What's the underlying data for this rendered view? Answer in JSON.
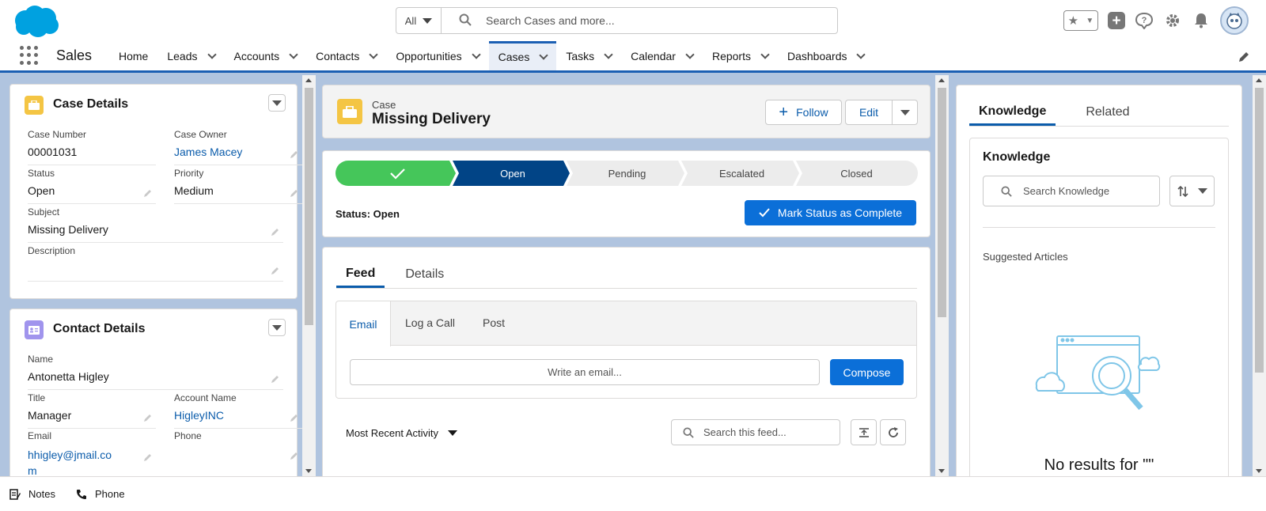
{
  "header": {
    "search_scope": "All",
    "search_placeholder": "Search Cases and more..."
  },
  "nav": {
    "app_name": "Sales",
    "items": [
      {
        "label": "Home",
        "has_menu": false
      },
      {
        "label": "Leads",
        "has_menu": true
      },
      {
        "label": "Accounts",
        "has_menu": true
      },
      {
        "label": "Contacts",
        "has_menu": true
      },
      {
        "label": "Opportunities",
        "has_menu": true
      },
      {
        "label": "Cases",
        "has_menu": true,
        "active": true
      },
      {
        "label": "Tasks",
        "has_menu": true
      },
      {
        "label": "Calendar",
        "has_menu": true
      },
      {
        "label": "Reports",
        "has_menu": true
      },
      {
        "label": "Dashboards",
        "has_menu": true
      }
    ]
  },
  "case_details": {
    "title": "Case Details",
    "case_number_label": "Case Number",
    "case_number": "00001031",
    "case_owner_label": "Case Owner",
    "case_owner": "James Macey",
    "status_label": "Status",
    "status": "Open",
    "priority_label": "Priority",
    "priority": "Medium",
    "subject_label": "Subject",
    "subject": "Missing Delivery",
    "description_label": "Description",
    "description": ""
  },
  "contact_details": {
    "title": "Contact Details",
    "name_label": "Name",
    "name": "Antonetta Higley",
    "title_label": "Title",
    "title_value": "Manager",
    "account_label": "Account Name",
    "account": "HigleyINC",
    "email_label": "Email",
    "email_line1": "hhigley@jmail.co",
    "email_line2": "m",
    "phone_label": "Phone",
    "phone": ""
  },
  "case_header": {
    "object_label": "Case",
    "record_name": "Missing Delivery",
    "follow_label": "Follow",
    "edit_label": "Edit"
  },
  "path": {
    "steps": [
      "",
      "Open",
      "Pending",
      "Escalated",
      "Closed"
    ],
    "status_text": "Status: Open",
    "mark_complete_label": "Mark Status as Complete"
  },
  "feed": {
    "tabs": [
      "Feed",
      "Details"
    ],
    "publisher_tabs": [
      "Email",
      "Log a Call",
      "Post"
    ],
    "email_placeholder": "Write an email...",
    "compose_label": "Compose",
    "sort_label": "Most Recent Activity",
    "search_placeholder": "Search this feed..."
  },
  "knowledge": {
    "tabs": [
      "Knowledge",
      "Related"
    ],
    "title": "Knowledge",
    "search_placeholder": "Search Knowledge",
    "suggested_label": "Suggested Articles",
    "no_results": "No results for \"\""
  },
  "footer": {
    "notes_label": "Notes",
    "phone_label": "Phone"
  },
  "colors": {
    "brand": "#0b6fd8",
    "path_complete": "#45c65a",
    "path_current": "#014486",
    "background": "#b0c4df",
    "case_icon": "#f4c544",
    "contact_icon": "#a094ed"
  }
}
